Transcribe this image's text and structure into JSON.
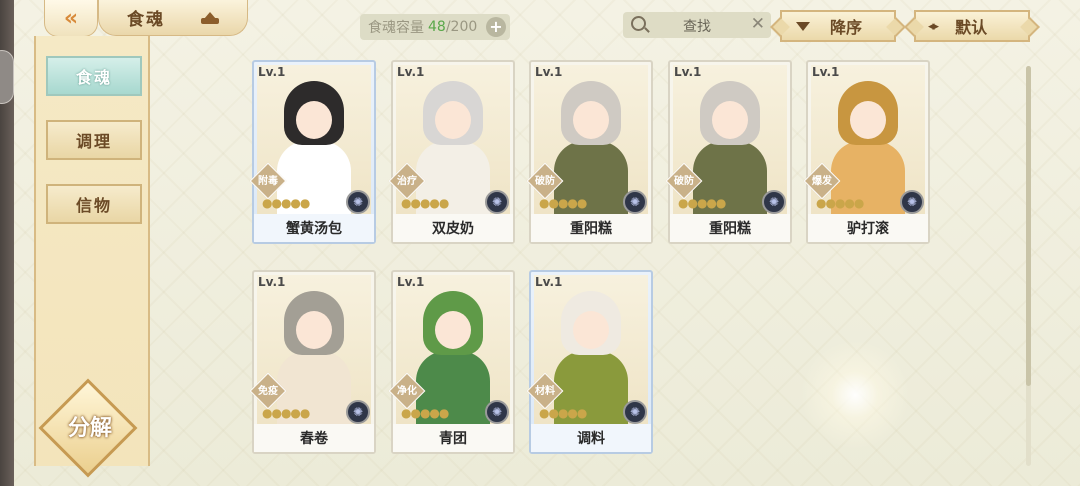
{
  "header": {
    "back_icon": "double-chevron-left-icon",
    "title": "食魂",
    "capacity_label": "食魂容量",
    "capacity_current": "48",
    "capacity_total": "/200",
    "search_label": "查找",
    "sort_label": "降序",
    "default_label": "默认"
  },
  "sidebar": {
    "items": [
      {
        "label": "食魂",
        "active": true
      },
      {
        "label": "调理",
        "active": false
      },
      {
        "label": "信物",
        "active": false
      }
    ],
    "decompose_label": "分解"
  },
  "cards": [
    {
      "level": "Lv.1",
      "role": "附毒",
      "name": "蟹黄汤包",
      "frame": "blue",
      "hair": "#2d2b2b",
      "body": "#ffffff"
    },
    {
      "level": "Lv.1",
      "role": "治疗",
      "name": "双皮奶",
      "frame": "white",
      "hair": "#d8d6d4",
      "body": "#f3efe6"
    },
    {
      "level": "Lv.1",
      "role": "破防",
      "name": "重阳糕",
      "frame": "white",
      "hair": "#cfcac3",
      "body": "#6e7348"
    },
    {
      "level": "Lv.1",
      "role": "破防",
      "name": "重阳糕",
      "frame": "white",
      "hair": "#cfcac3",
      "body": "#6e7348"
    },
    {
      "level": "Lv.1",
      "role": "爆发",
      "name": "驴打滚",
      "frame": "white",
      "hair": "#c89640",
      "body": "#e7b264"
    },
    {
      "level": "Lv.1",
      "role": "免疫",
      "name": "春卷",
      "frame": "white",
      "hair": "#a39f95",
      "body": "#f1e5d2"
    },
    {
      "level": "Lv.1",
      "role": "净化",
      "name": "青团",
      "frame": "white",
      "hair": "#5f9a48",
      "body": "#4d8a4a"
    },
    {
      "level": "Lv.1",
      "role": "材料",
      "name": "调料",
      "frame": "blue",
      "hair": "#efeae1",
      "body": "#8a9a3c"
    }
  ]
}
